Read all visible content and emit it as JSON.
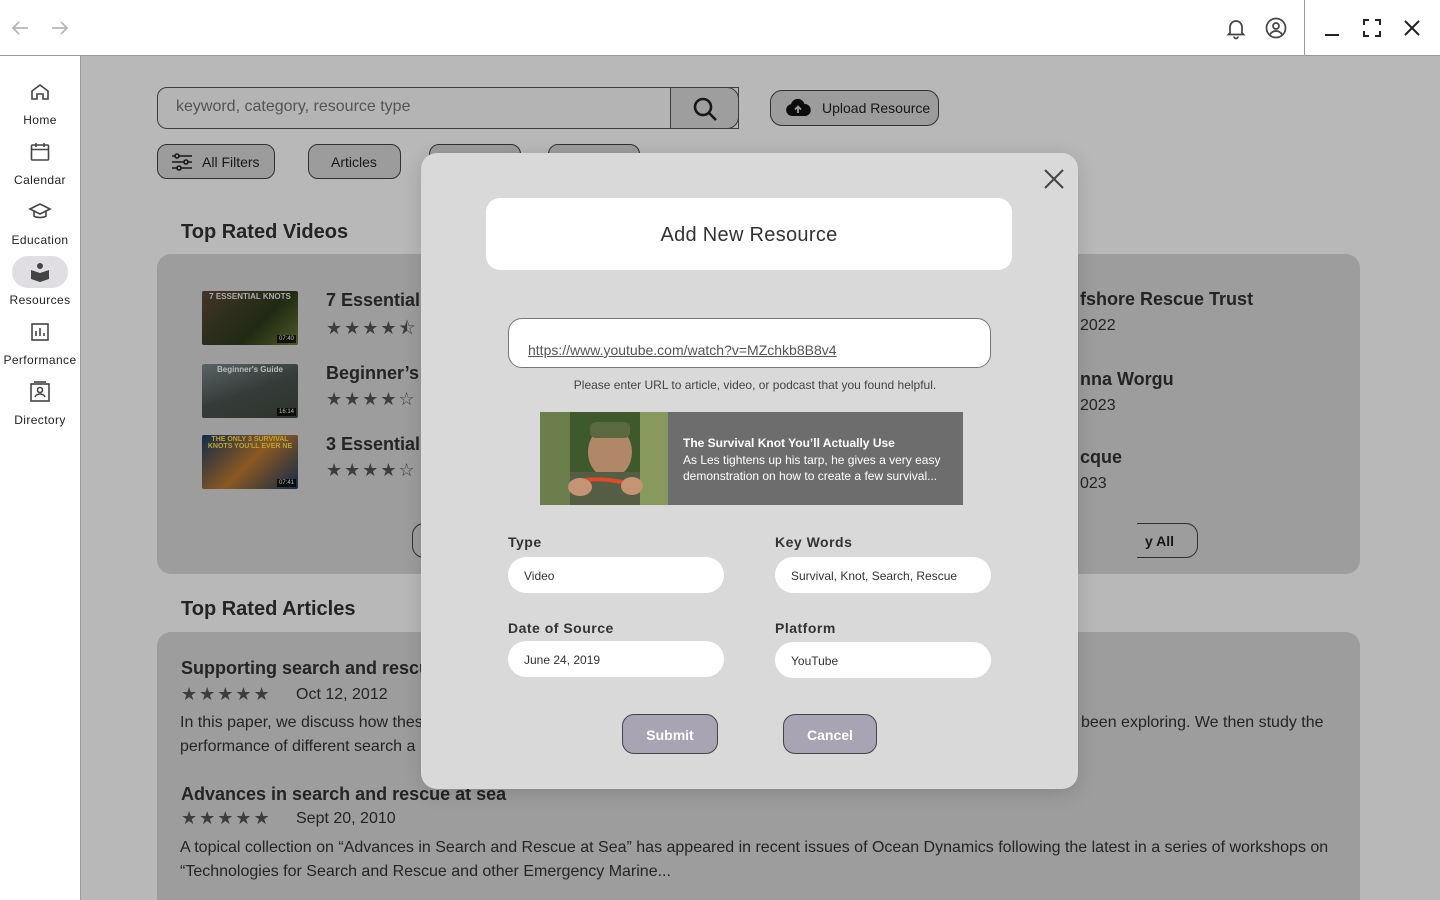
{
  "colors": {
    "accent_button": "#a9a4b3",
    "panel_gray": "#dadada",
    "modal_bg": "#d9d9d9",
    "preview_bg": "#6d6d6d"
  },
  "titlebar": {
    "icons": [
      "back-arrow-icon",
      "forward-arrow-icon",
      "bell-icon",
      "account-circle-icon",
      "minimize-icon",
      "maximize-icon",
      "close-icon"
    ]
  },
  "sidebar": {
    "items": [
      {
        "label": "Home",
        "icon": "home-icon"
      },
      {
        "label": "Calendar",
        "icon": "calendar-icon"
      },
      {
        "label": "Education",
        "icon": "graduation-cap-icon"
      },
      {
        "label": "Resources",
        "icon": "book-icon",
        "active": true
      },
      {
        "label": "Performance",
        "icon": "bar-chart-icon"
      },
      {
        "label": "Directory",
        "icon": "contact-card-icon"
      }
    ]
  },
  "search": {
    "placeholder": "keyword, category, resource type"
  },
  "upload_label": "Upload Resource",
  "filters": {
    "all": "All Filters",
    "articles": "Articles"
  },
  "top_videos": {
    "title": "Top Rated Videos",
    "items": [
      {
        "title": "7 Essential I",
        "thumb_caption": "7 ESSENTIAL KNOTS",
        "duration": "07:40",
        "stars": "★★★★⯪"
      },
      {
        "title": "Beginner’s G",
        "thumb_caption": "Beginner's Guide",
        "duration": "16:14",
        "stars": "★★★★☆"
      },
      {
        "title": "3 Essential S",
        "thumb_caption": "THE ONLY 3 SURVIVAL KNOTS YOU'LL EVER NE",
        "duration": "07:41",
        "stars": "★★★★☆"
      }
    ],
    "right_items": [
      {
        "title": "fshore Rescue Trust",
        "date": "2022"
      },
      {
        "title": "nna Worgu",
        "date": " 2023"
      },
      {
        "title": "cque",
        "date": "023"
      }
    ],
    "view_all": "y All"
  },
  "top_articles": {
    "title": "Top Rated Articles",
    "items": [
      {
        "title": "Supporting search and rescue",
        "stars": "★★★★★",
        "date": "Oct 12, 2012",
        "body_line1": "In this paper, we discuss how thes",
        "body_line1_right": "been exploring. We then study the",
        "body_line2": "performance of different search a"
      },
      {
        "title": "Advances in search and rescue at sea",
        "stars": "★★★★★",
        "date": "Sept 20, 2010",
        "body_line1": "A topical collection on “Advances in Search and Rescue at Sea” has appeared in recent issues of Ocean Dynamics following the latest in a series of workshops on",
        "body_line2": "“Technologies for Search and Rescue and other Emergency Marine..."
      }
    ]
  },
  "modal": {
    "title": "Add New Resource",
    "url_value": "https://www.youtube.com/watch?v=MZchkb8B8v4",
    "hint": "Please enter URL to article, video, or podcast that you found helpful.",
    "preview": {
      "title": "The Survival Knot You’ll Actually Use",
      "description": "As Les tightens up his tarp, he gives a very easy demonstration on how to create a few survival..."
    },
    "fields": {
      "type": {
        "label": "Type",
        "value": "Video"
      },
      "keywords": {
        "label": "Key Words",
        "value": "Survival, Knot, Search, Rescue"
      },
      "date": {
        "label": "Date of Source",
        "value": "June 24, 2019"
      },
      "platform": {
        "label": "Platform",
        "value": "YouTube"
      }
    },
    "submit": "Submit",
    "cancel": "Cancel"
  }
}
